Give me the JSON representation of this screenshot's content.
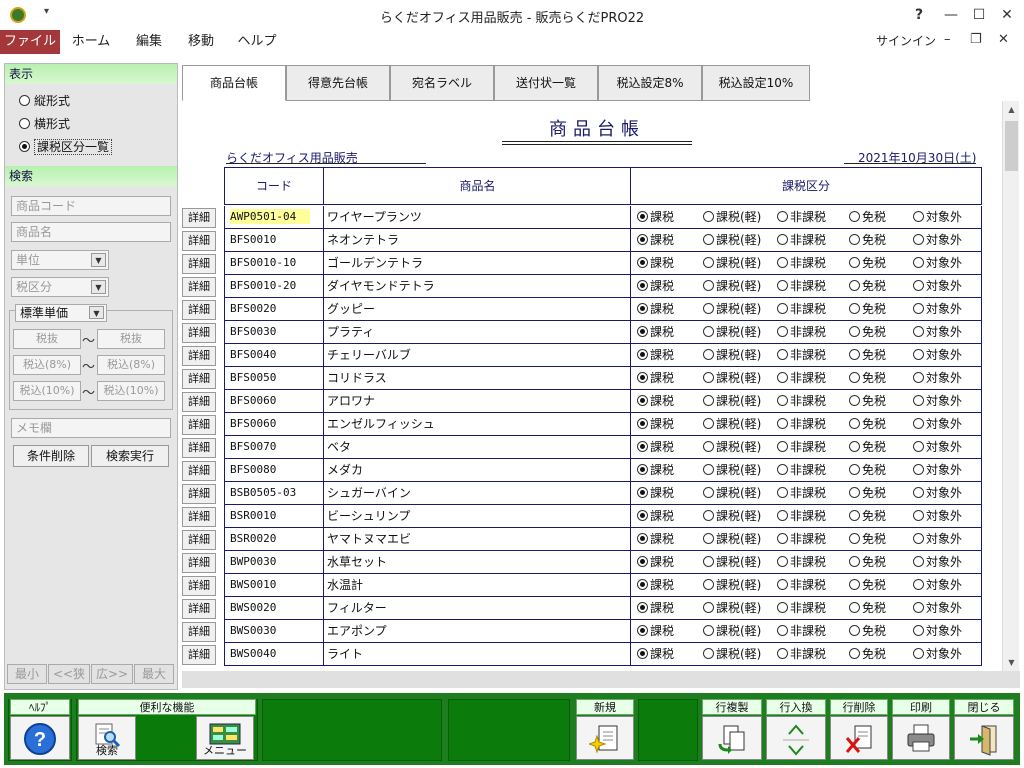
{
  "window": {
    "title": "らくだオフィス用品販売 - 販売らくだPRO22",
    "help": "?",
    "minimize": "—",
    "maximize": "☐",
    "close": "✕"
  },
  "menu": {
    "items": [
      "ファイル",
      "ホーム",
      "編集",
      "移動",
      "ヘルプ"
    ],
    "active": "ファイル",
    "signin": "サインイン",
    "ribbon_min": "–",
    "ribbon_restore": "❐",
    "ribbon_close": "✕"
  },
  "left_panel": {
    "display_header": "表示",
    "display_options": [
      {
        "label": "縦形式",
        "selected": false
      },
      {
        "label": "横形式",
        "selected": false
      },
      {
        "label": "課税区分一覧",
        "selected": true
      }
    ],
    "search_header": "検索",
    "product_code_placeholder": "商品コード",
    "product_name_placeholder": "商品名",
    "unit_placeholder": "単位",
    "tax_class_placeholder": "税区分",
    "price_type": "標準単価",
    "tax_excl": "税抜",
    "tax_incl_8": "税込(8%)",
    "tax_incl_10": "税込(10%)",
    "range_sep": "〜",
    "memo_placeholder": "メモ欄",
    "clear_button": "条件削除",
    "search_button": "検索実行",
    "nav": {
      "min": "最小",
      "narrow": "<<狭",
      "wide": "広>>",
      "max": "最大"
    }
  },
  "tabs": [
    {
      "label": "商品台帳",
      "active": true
    },
    {
      "label": "得意先台帳",
      "active": false
    },
    {
      "label": "宛名ラベル",
      "active": false
    },
    {
      "label": "送付状一覧",
      "active": false
    },
    {
      "label": "税込設定8%",
      "active": false
    },
    {
      "label": "税込設定10%",
      "active": false
    }
  ],
  "sheet": {
    "title": "商品台帳",
    "company": "らくだオフィス用品販売",
    "date": "2021年10月30日(土)",
    "columns": {
      "code": "コード",
      "name": "商品名",
      "tax": "課税区分"
    },
    "detail_label": "詳細",
    "tax_options": [
      "課税",
      "課税(軽)",
      "非課税",
      "免税",
      "対象外"
    ],
    "rows": [
      {
        "code": "AWP0501-04",
        "name": "ワイヤープランツ",
        "tax": 0,
        "highlight": true
      },
      {
        "code": "BFS0010",
        "name": "ネオンテトラ",
        "tax": 0
      },
      {
        "code": "BFS0010-10",
        "name": "ゴールデンテトラ",
        "tax": 0
      },
      {
        "code": "BFS0010-20",
        "name": "ダイヤモンドテトラ",
        "tax": 0
      },
      {
        "code": "BFS0020",
        "name": "グッピー",
        "tax": 0
      },
      {
        "code": "BFS0030",
        "name": "プラティ",
        "tax": 0
      },
      {
        "code": "BFS0040",
        "name": "チェリーバルブ",
        "tax": 0
      },
      {
        "code": "BFS0050",
        "name": "コリドラス",
        "tax": 0
      },
      {
        "code": "BFS0060",
        "name": "アロワナ",
        "tax": 0
      },
      {
        "code": "BFS0060",
        "name": "エンゼルフィッシュ",
        "tax": 0
      },
      {
        "code": "BFS0070",
        "name": "ベタ",
        "tax": 0
      },
      {
        "code": "BFS0080",
        "name": "メダカ",
        "tax": 0
      },
      {
        "code": "BSB0505-03",
        "name": "シュガーバイン",
        "tax": 0
      },
      {
        "code": "BSR0010",
        "name": "ビーシュリンプ",
        "tax": 0
      },
      {
        "code": "BSR0020",
        "name": "ヤマトヌマエビ",
        "tax": 0
      },
      {
        "code": "BWP0030",
        "name": "水草セット",
        "tax": 0
      },
      {
        "code": "BWS0010",
        "name": "水温計",
        "tax": 0
      },
      {
        "code": "BWS0020",
        "name": "フィルター",
        "tax": 0
      },
      {
        "code": "BWS0030",
        "name": "エアポンプ",
        "tax": 0
      },
      {
        "code": "BWS0040",
        "name": "ライト",
        "tax": 0
      }
    ]
  },
  "toolbar": {
    "help_label": "ﾍﾙﾌﾟ",
    "tools_label": "便利な機能",
    "search_caption": "検索",
    "menu_caption": "メニュー",
    "new_label": "新規",
    "copy_row_label": "行複製",
    "swap_row_label": "行入換",
    "delete_row_label": "行削除",
    "print_label": "印刷",
    "close_label": "閉じる"
  },
  "icons": [
    "app-icon",
    "help-icon",
    "search-icon",
    "menu-icon",
    "new-icon",
    "copy-row-icon",
    "up-arrow-icon",
    "down-arrow-icon",
    "delete-row-icon",
    "printer-icon",
    "exit-icon"
  ]
}
